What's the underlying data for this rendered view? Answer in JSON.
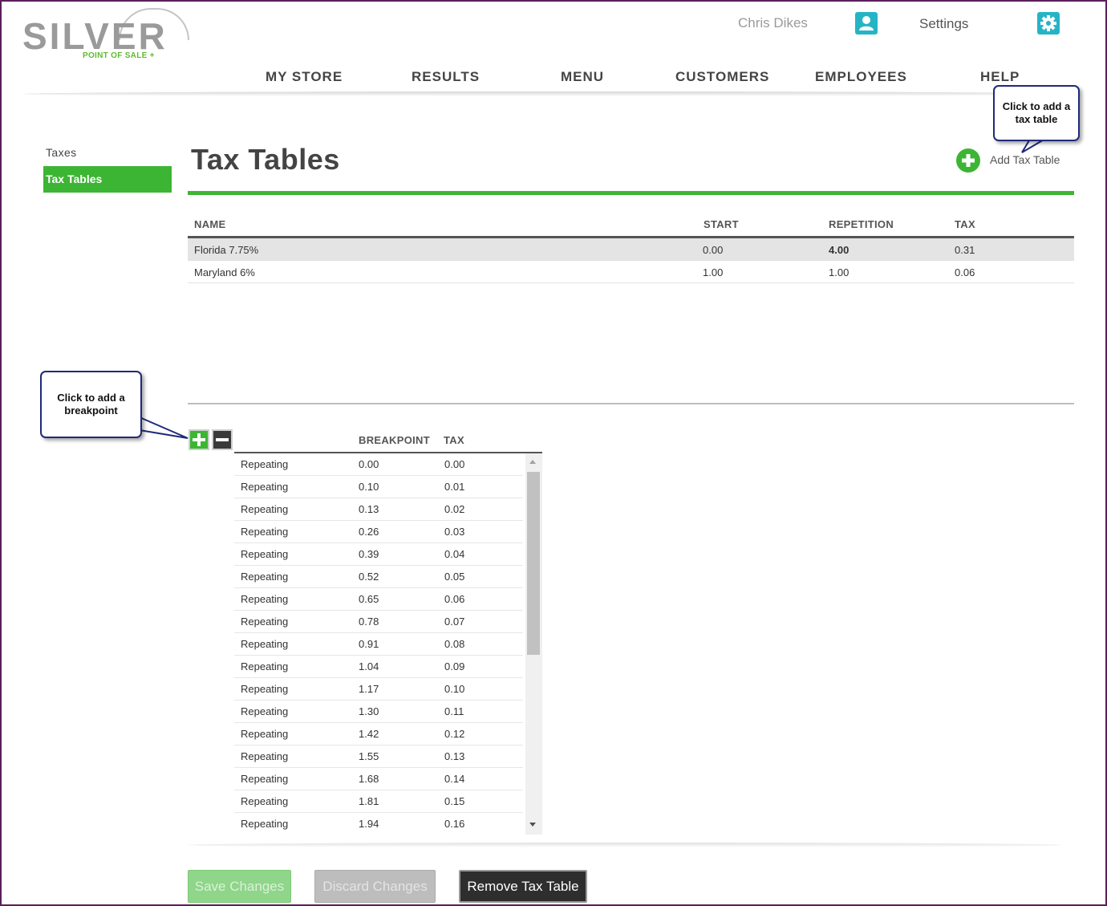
{
  "brand": {
    "name": "SILVER",
    "tagline": "POINT OF SALE +"
  },
  "header": {
    "user_name": "Chris Dikes",
    "settings_label": "Settings"
  },
  "nav": [
    {
      "label": "MY STORE"
    },
    {
      "label": "RESULTS"
    },
    {
      "label": "MENU"
    },
    {
      "label": "CUSTOMERS"
    },
    {
      "label": "EMPLOYEES"
    },
    {
      "label": "HELP"
    }
  ],
  "sidebar": {
    "items": [
      {
        "label": "Taxes",
        "active": false
      },
      {
        "label": "Tax Tables",
        "active": true
      }
    ]
  },
  "page": {
    "title": "Tax Tables",
    "add_label": "Add Tax Table"
  },
  "callouts": {
    "add_tax_table": "Click to add a tax table",
    "add_breakpoint": "Click to add a breakpoint"
  },
  "tax_tables": {
    "columns": [
      "NAME",
      "START",
      "REPETITION",
      "TAX"
    ],
    "rows": [
      {
        "name": "Florida 7.75%",
        "start": "0.00",
        "repetition": "4.00",
        "tax": "0.31",
        "selected": true
      },
      {
        "name": "Maryland 6%",
        "start": "1.00",
        "repetition": "1.00",
        "tax": "0.06",
        "selected": false
      }
    ]
  },
  "breakpoints": {
    "columns": [
      "BREAKPOINT",
      "TAX"
    ],
    "rows": [
      {
        "type": "Repeating",
        "breakpoint": "0.00",
        "tax": "0.00"
      },
      {
        "type": "Repeating",
        "breakpoint": "0.10",
        "tax": "0.01"
      },
      {
        "type": "Repeating",
        "breakpoint": "0.13",
        "tax": "0.02"
      },
      {
        "type": "Repeating",
        "breakpoint": "0.26",
        "tax": "0.03"
      },
      {
        "type": "Repeating",
        "breakpoint": "0.39",
        "tax": "0.04"
      },
      {
        "type": "Repeating",
        "breakpoint": "0.52",
        "tax": "0.05"
      },
      {
        "type": "Repeating",
        "breakpoint": "0.65",
        "tax": "0.06"
      },
      {
        "type": "Repeating",
        "breakpoint": "0.78",
        "tax": "0.07"
      },
      {
        "type": "Repeating",
        "breakpoint": "0.91",
        "tax": "0.08"
      },
      {
        "type": "Repeating",
        "breakpoint": "1.04",
        "tax": "0.09"
      },
      {
        "type": "Repeating",
        "breakpoint": "1.17",
        "tax": "0.10"
      },
      {
        "type": "Repeating",
        "breakpoint": "1.30",
        "tax": "0.11"
      },
      {
        "type": "Repeating",
        "breakpoint": "1.42",
        "tax": "0.12"
      },
      {
        "type": "Repeating",
        "breakpoint": "1.55",
        "tax": "0.13"
      },
      {
        "type": "Repeating",
        "breakpoint": "1.68",
        "tax": "0.14"
      },
      {
        "type": "Repeating",
        "breakpoint": "1.81",
        "tax": "0.15"
      },
      {
        "type": "Repeating",
        "breakpoint": "1.94",
        "tax": "0.16"
      }
    ]
  },
  "actions": {
    "save": "Save Changes",
    "discard": "Discard Changes",
    "remove": "Remove Tax Table"
  },
  "colors": {
    "accent": "#3db534",
    "icon_bg": "#25b4c6",
    "frame": "#5a1f5a"
  }
}
